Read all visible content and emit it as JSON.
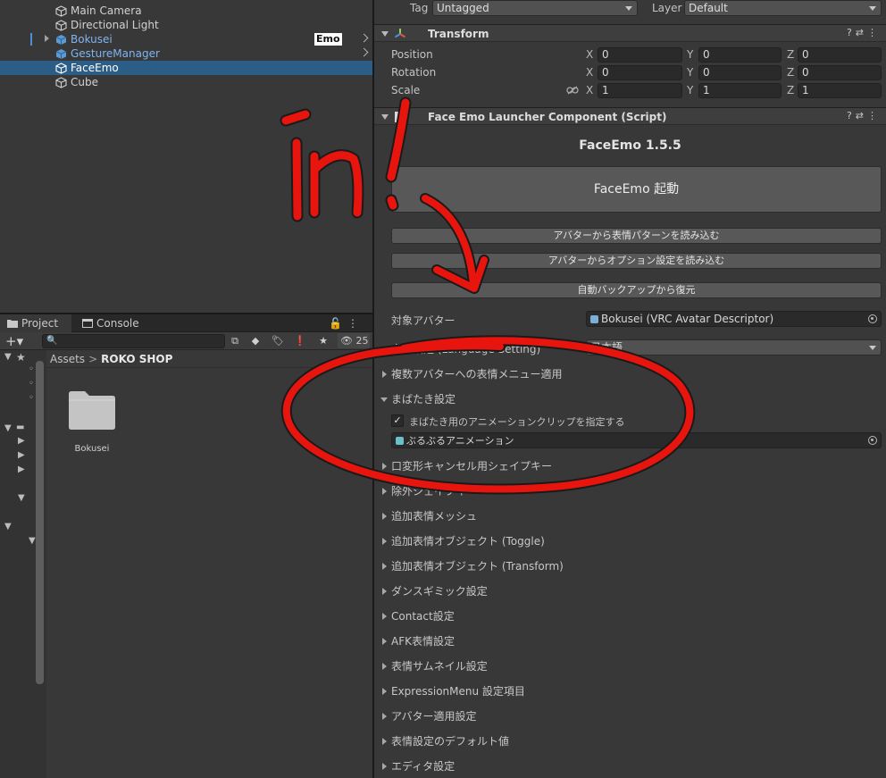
{
  "hierarchy": {
    "items": [
      {
        "label": "Main Camera"
      },
      {
        "label": "Directional Light"
      },
      {
        "label": "Bokusei"
      },
      {
        "label": "GestureManager"
      },
      {
        "label": "FaceEmo"
      },
      {
        "label": "Cube"
      }
    ],
    "badge": "Emo"
  },
  "project": {
    "tabs": [
      {
        "label": "Project"
      },
      {
        "label": "Console"
      }
    ],
    "hidden_count": "25",
    "breadcrumb": {
      "root": "Assets",
      "sep": ">",
      "current": "ROKO SHOP"
    },
    "folder_label": "Bokusei"
  },
  "inspector": {
    "tag_label": "Tag",
    "tag_value": "Untagged",
    "layer_label": "Layer",
    "layer_value": "Default",
    "transform": {
      "title": "Transform",
      "rows": [
        {
          "label": "Position",
          "x": "0",
          "y": "0",
          "z": "0"
        },
        {
          "label": "Rotation",
          "x": "0",
          "y": "0",
          "z": "0"
        },
        {
          "label": "Scale",
          "x": "1",
          "y": "1",
          "z": "1"
        }
      ],
      "axis": {
        "x": "X",
        "y": "Y",
        "z": "Z"
      }
    },
    "launcher": {
      "title": "Face Emo Launcher Component (Script)",
      "version": "FaceEmo 1.5.5",
      "launch_button": "FaceEmo 起動",
      "buttons": [
        "アバターから表情パターンを読み込む",
        "アバターからオプション設定を読み込む",
        "自動バックアップから復元"
      ],
      "target_avatar_label": "対象アバター",
      "target_avatar_value": "Bokusei (VRC Avatar Descriptor)",
      "language_label": "言語設定 (Language Setting)",
      "language_value": "日本語",
      "multi_avatar_label": "複数アバターへの表情メニュー適用",
      "blink": {
        "label": "まばたき設定",
        "checkbox_label": "まばたき用のアニメーションクリップを指定する",
        "checkbox_mark": "✓",
        "clip_value": "ぶるぶるアニメーション"
      },
      "foldouts": [
        "口変形キャンセル用シェイプキー",
        "除外シェイプキー",
        "追加表情メッシュ",
        "追加表情オブジェクト (Toggle)",
        "追加表情オブジェクト (Transform)",
        "ダンスギミック設定",
        "Contact設定",
        "AFK表情設定",
        "表情サムネイル設定",
        "ExpressionMenu 設定項目",
        "アバター適用設定",
        "表情設定のデフォルト値",
        "エディタ設定"
      ]
    }
  },
  "annotation": {
    "color": "#e8150f"
  }
}
